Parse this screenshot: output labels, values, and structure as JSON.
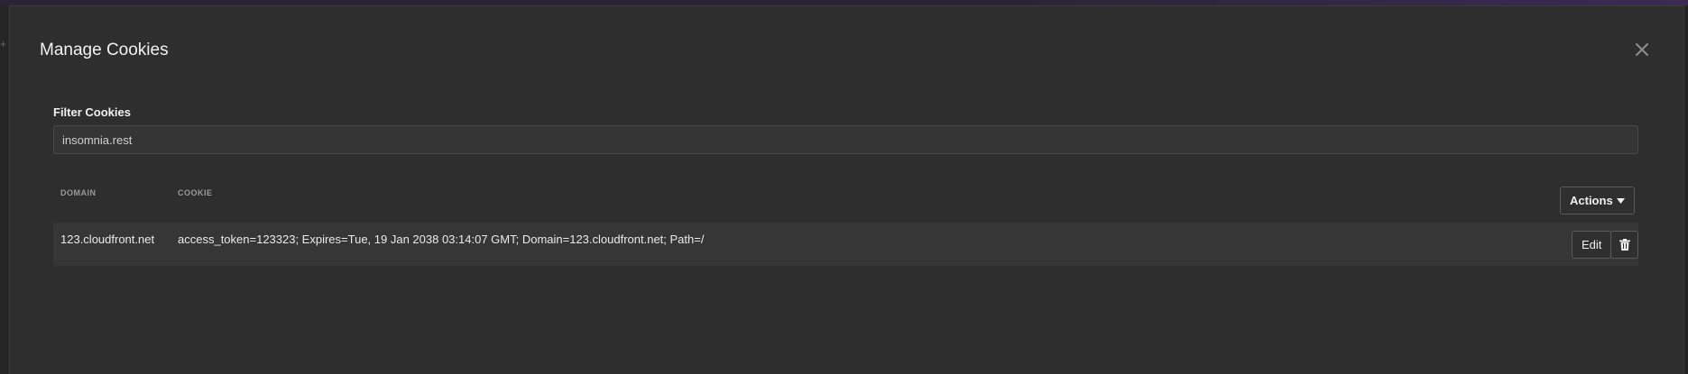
{
  "dialog": {
    "title": "Manage Cookies",
    "close_icon": "close-icon"
  },
  "filter": {
    "label": "Filter Cookies",
    "value": "insomnia.rest"
  },
  "table": {
    "columns": [
      "DOMAIN",
      "COOKIE"
    ],
    "actions_label": "Actions",
    "actions_icon": "caret-down-icon",
    "rows": [
      {
        "domain": "123.cloudfront.net",
        "cookie": "access_token=123323; Expires=Tue, 19 Jan 2038 03:14:07 GMT; Domain=123.cloudfront.net; Path=/",
        "edit_label": "Edit",
        "delete_icon": "trash-icon"
      }
    ]
  },
  "colors": {
    "background": "#2e2e2e",
    "row_background": "#363636",
    "input_background": "#353535",
    "text": "#eaeaea",
    "muted": "#9a9a9a"
  }
}
